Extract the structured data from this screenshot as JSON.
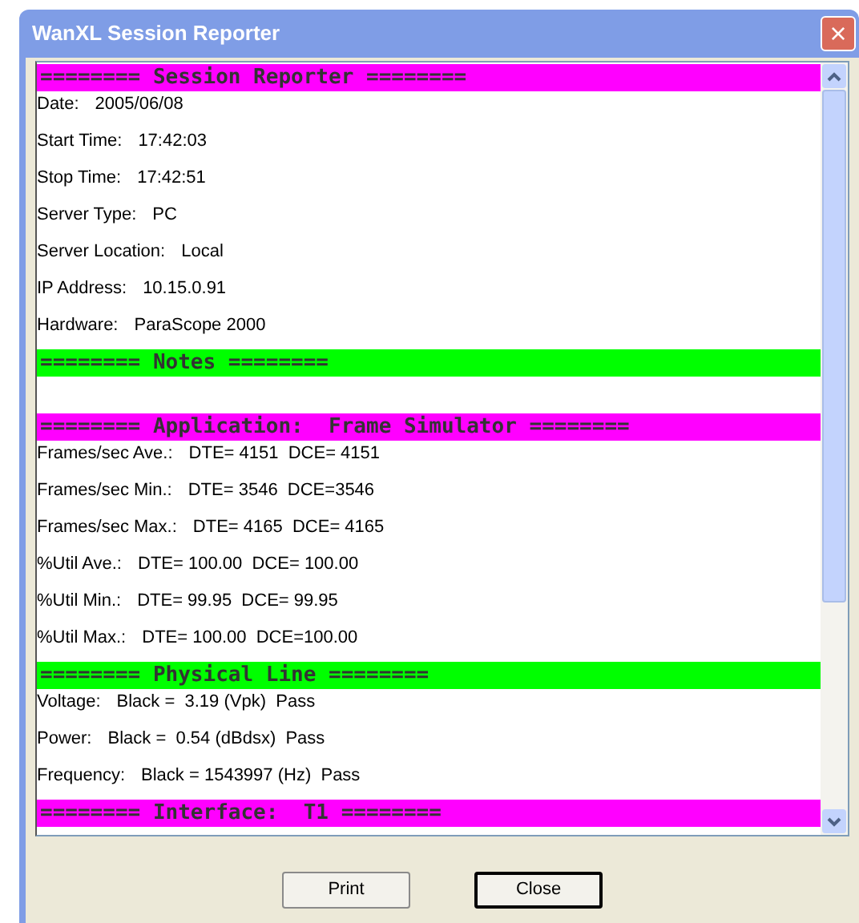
{
  "window": {
    "title": "WanXL Session Reporter",
    "close": "×"
  },
  "report": [
    {
      "kind": "header",
      "text": "======== Session Reporter ========",
      "color": "#ff00ff"
    },
    {
      "kind": "field",
      "label": "Date:",
      "value": "2005/06/08"
    },
    {
      "kind": "field",
      "label": "Start Time:",
      "value": "17:42:03"
    },
    {
      "kind": "field",
      "label": "Stop Time:",
      "value": "17:42:51"
    },
    {
      "kind": "field",
      "label": "Server Type:",
      "value": "PC"
    },
    {
      "kind": "field",
      "label": "Server Location:",
      "value": "Local"
    },
    {
      "kind": "field",
      "label": "IP Address:",
      "value": "10.15.0.91"
    },
    {
      "kind": "field",
      "label": "Hardware:",
      "value": "ParaScope 2000"
    },
    {
      "kind": "header",
      "text": "======== Notes ========",
      "color": "#00ff00"
    },
    {
      "kind": "blank"
    },
    {
      "kind": "header",
      "text": "======== Application:  Frame Simulator ========",
      "color": "#ff00ff"
    },
    {
      "kind": "field",
      "label": "Frames/sec Ave.:",
      "value": "DTE= 4151  DCE= 4151"
    },
    {
      "kind": "field",
      "label": "Frames/sec Min.:",
      "value": "DTE= 3546  DCE=3546"
    },
    {
      "kind": "field",
      "label": "Frames/sec Max.:",
      "value": "DTE= 4165  DCE= 4165"
    },
    {
      "kind": "field",
      "label": "%Util Ave.:",
      "value": "DTE= 100.00  DCE= 100.00"
    },
    {
      "kind": "field",
      "label": "%Util Min.:",
      "value": "DTE= 99.95  DCE= 99.95"
    },
    {
      "kind": "field",
      "label": "%Util Max.:",
      "value": "DTE= 100.00  DCE=100.00"
    },
    {
      "kind": "header",
      "text": "======== Physical Line ========",
      "color": "#00ff00"
    },
    {
      "kind": "field",
      "label": "Voltage:",
      "value": "Black =  3.19 (Vpk)  Pass"
    },
    {
      "kind": "field",
      "label": "Power:",
      "value": "Black =  0.54 (dBdsx)  Pass"
    },
    {
      "kind": "field",
      "label": "Frequency:",
      "value": "Black = 1543997 (Hz)  Pass"
    },
    {
      "kind": "header",
      "text": "======== Interface:  T1 ========",
      "color": "#ff00ff"
    }
  ],
  "buttons": [
    "Print",
    "Close"
  ]
}
